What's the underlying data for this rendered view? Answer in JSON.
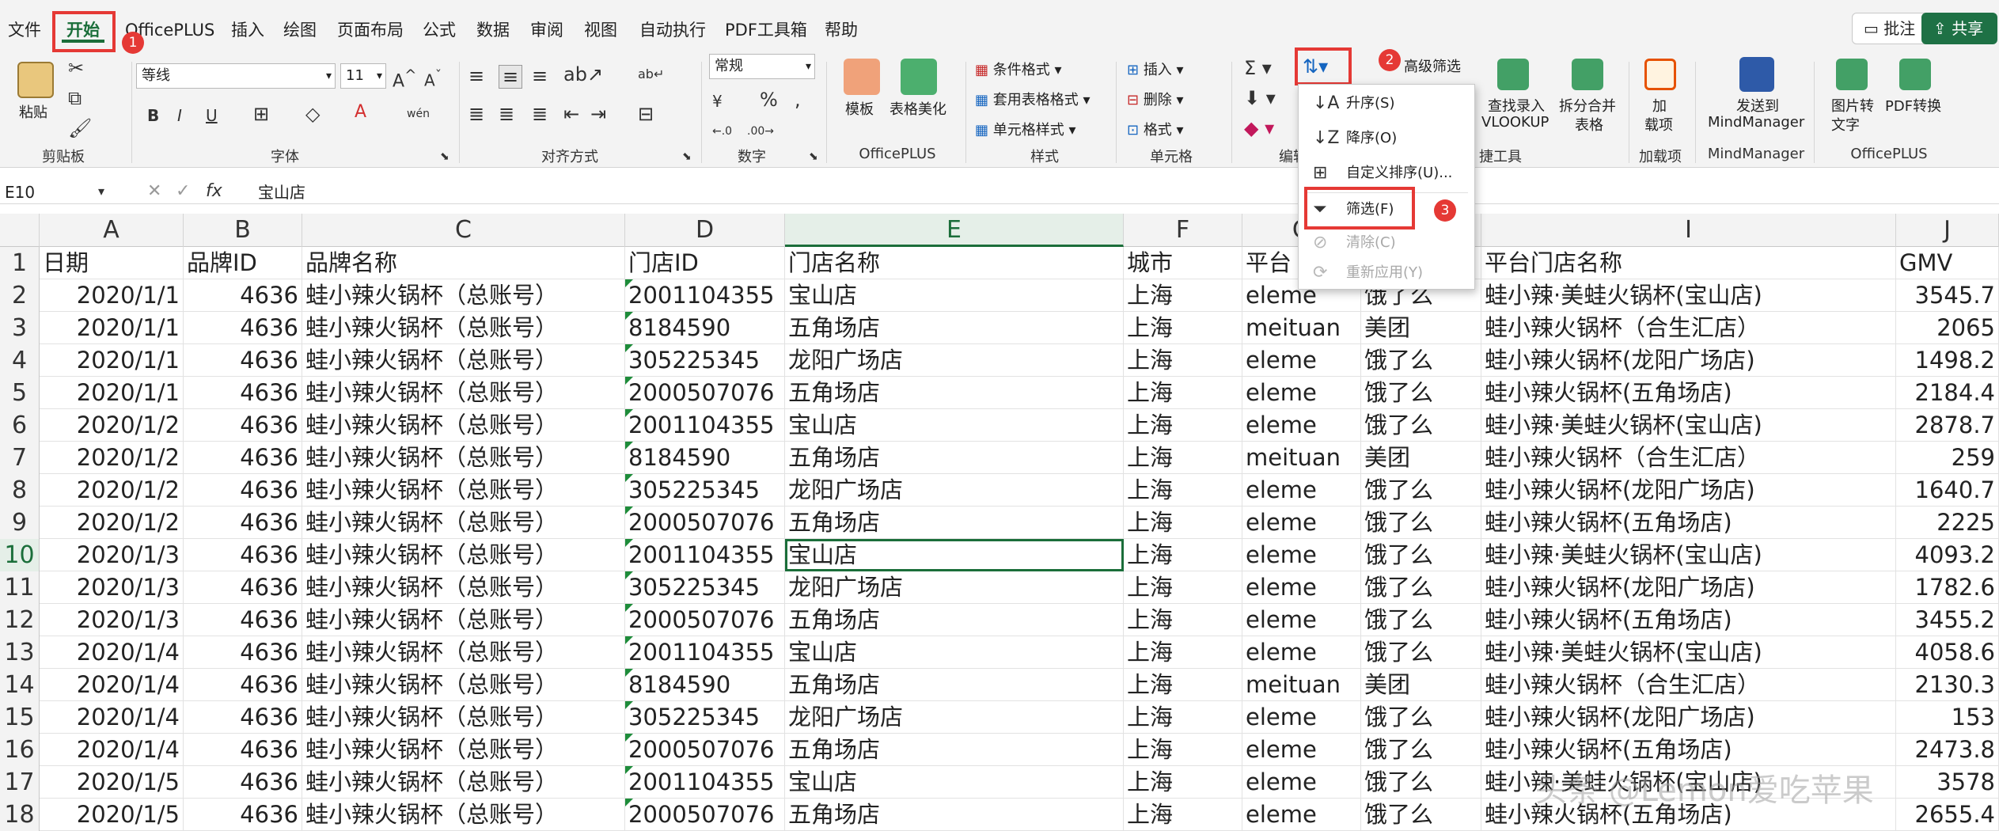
{
  "menu": {
    "tabs": [
      "文件",
      "开始",
      "OfficePLUS",
      "插入",
      "绘图",
      "页面布局",
      "公式",
      "数据",
      "审阅",
      "视图",
      "自动执行",
      "PDF工具箱",
      "帮助"
    ],
    "comment_btn": "批注",
    "share_btn": "共享"
  },
  "ribbon": {
    "clipboard": {
      "paste": "粘贴",
      "label": "剪贴板"
    },
    "font": {
      "name": "等线",
      "size": "11",
      "label": "字体"
    },
    "alignment": {
      "label": "对齐方式"
    },
    "number": {
      "format": "常规",
      "label": "数字"
    },
    "officeplus": {
      "template": "模板",
      "beautify": "表格美化",
      "label": "OfficePLUS"
    },
    "styles": {
      "cond": "条件格式",
      "table": "套用表格格式",
      "cell": "单元格样式",
      "label": "样式"
    },
    "cells": {
      "insert": "插入",
      "delete": "删除",
      "format": "格式",
      "label": "单元格"
    },
    "editing": {
      "label": "编辑"
    },
    "convenience": {
      "adv_filter": "高级筛选",
      "vlookup1": "查找录入",
      "vlookup2": "VLOOKUP",
      "split1": "拆分合并",
      "split2": "表格",
      "label": "捷工具"
    },
    "addins": {
      "btn1": "加",
      "btn2": "载项",
      "label": "加载项"
    },
    "mindmanager": {
      "btn1": "发送到",
      "btn2": "MindManager",
      "label": "MindManager"
    },
    "officeplus2": {
      "img1": "图片转",
      "img2": "文字",
      "pdf": "PDF转换",
      "label": "OfficePLUS"
    }
  },
  "formula_bar": {
    "name_box": "E10",
    "formula": "宝山店"
  },
  "sort_menu": {
    "items": [
      {
        "label": "升序(S)",
        "icon": "sort-ascending-icon",
        "enabled": true
      },
      {
        "label": "降序(O)",
        "icon": "sort-descending-icon",
        "enabled": true
      },
      {
        "label": "自定义排序(U)...",
        "icon": "custom-sort-icon",
        "enabled": true
      },
      {
        "label": "筛选(F)",
        "icon": "filter-icon",
        "enabled": true
      },
      {
        "label": "清除(C)",
        "icon": "clear-filter-icon",
        "enabled": false
      },
      {
        "label": "重新应用(Y)",
        "icon": "reapply-icon",
        "enabled": false
      }
    ]
  },
  "annotations": {
    "badge1": "1",
    "badge2": "2",
    "badge3": "3"
  },
  "sheet": {
    "columns": [
      "A",
      "B",
      "C",
      "D",
      "E",
      "F",
      "G",
      "H",
      "I",
      "J"
    ],
    "selected_column": "E",
    "row_numbers": [
      "1",
      "2",
      "3",
      "4",
      "5",
      "6",
      "7",
      "8",
      "9",
      "10",
      "11",
      "12",
      "13",
      "14",
      "15",
      "16",
      "17",
      "18"
    ],
    "selected_row": "10",
    "header": [
      "日期",
      "品牌ID",
      "品牌名称",
      "门店ID",
      "门店名称",
      "城市",
      "平台",
      "",
      "平台门店名称",
      "GMV"
    ],
    "rows": [
      [
        "2020/1/1",
        "4636",
        "蛙小辣火锅杯（总账号）",
        "2001104355",
        "宝山店",
        "上海",
        "eleme",
        "饿了么",
        "蛙小辣·美蛙火锅杯(宝山店)",
        "3545.7"
      ],
      [
        "2020/1/1",
        "4636",
        "蛙小辣火锅杯（总账号）",
        "8184590",
        "五角场店",
        "上海",
        "meituan",
        "美团",
        "蛙小辣火锅杯（合生汇店）",
        "2065"
      ],
      [
        "2020/1/1",
        "4636",
        "蛙小辣火锅杯（总账号）",
        "305225345",
        "龙阳广场店",
        "上海",
        "eleme",
        "饿了么",
        "蛙小辣火锅杯(龙阳广场店)",
        "1498.2"
      ],
      [
        "2020/1/1",
        "4636",
        "蛙小辣火锅杯（总账号）",
        "2000507076",
        "五角场店",
        "上海",
        "eleme",
        "饿了么",
        "蛙小辣火锅杯(五角场店)",
        "2184.4"
      ],
      [
        "2020/1/2",
        "4636",
        "蛙小辣火锅杯（总账号）",
        "2001104355",
        "宝山店",
        "上海",
        "eleme",
        "饿了么",
        "蛙小辣·美蛙火锅杯(宝山店)",
        "2878.7"
      ],
      [
        "2020/1/2",
        "4636",
        "蛙小辣火锅杯（总账号）",
        "8184590",
        "五角场店",
        "上海",
        "meituan",
        "美团",
        "蛙小辣火锅杯（合生汇店）",
        "259"
      ],
      [
        "2020/1/2",
        "4636",
        "蛙小辣火锅杯（总账号）",
        "305225345",
        "龙阳广场店",
        "上海",
        "eleme",
        "饿了么",
        "蛙小辣火锅杯(龙阳广场店)",
        "1640.7"
      ],
      [
        "2020/1/2",
        "4636",
        "蛙小辣火锅杯（总账号）",
        "2000507076",
        "五角场店",
        "上海",
        "eleme",
        "饿了么",
        "蛙小辣火锅杯(五角场店)",
        "2225"
      ],
      [
        "2020/1/3",
        "4636",
        "蛙小辣火锅杯（总账号）",
        "2001104355",
        "宝山店",
        "上海",
        "eleme",
        "饿了么",
        "蛙小辣·美蛙火锅杯(宝山店)",
        "4093.2"
      ],
      [
        "2020/1/3",
        "4636",
        "蛙小辣火锅杯（总账号）",
        "305225345",
        "龙阳广场店",
        "上海",
        "eleme",
        "饿了么",
        "蛙小辣火锅杯(龙阳广场店)",
        "1782.6"
      ],
      [
        "2020/1/3",
        "4636",
        "蛙小辣火锅杯（总账号）",
        "2000507076",
        "五角场店",
        "上海",
        "eleme",
        "饿了么",
        "蛙小辣火锅杯(五角场店)",
        "3455.2"
      ],
      [
        "2020/1/4",
        "4636",
        "蛙小辣火锅杯（总账号）",
        "2001104355",
        "宝山店",
        "上海",
        "eleme",
        "饿了么",
        "蛙小辣·美蛙火锅杯(宝山店)",
        "4058.6"
      ],
      [
        "2020/1/4",
        "4636",
        "蛙小辣火锅杯（总账号）",
        "8184590",
        "五角场店",
        "上海",
        "meituan",
        "美团",
        "蛙小辣火锅杯（合生汇店）",
        "2130.3"
      ],
      [
        "2020/1/4",
        "4636",
        "蛙小辣火锅杯（总账号）",
        "305225345",
        "龙阳广场店",
        "上海",
        "eleme",
        "饿了么",
        "蛙小辣火锅杯(龙阳广场店)",
        "153"
      ],
      [
        "2020/1/4",
        "4636",
        "蛙小辣火锅杯（总账号）",
        "2000507076",
        "五角场店",
        "上海",
        "eleme",
        "饿了么",
        "蛙小辣火锅杯(五角场店)",
        "2473.8"
      ],
      [
        "2020/1/5",
        "4636",
        "蛙小辣火锅杯（总账号）",
        "2001104355",
        "宝山店",
        "上海",
        "eleme",
        "饿了么",
        "蛙小辣·美蛙火锅杯(宝山店)",
        "3578"
      ],
      [
        "2020/1/5",
        "4636",
        "蛙小辣火锅杯（总账号）",
        "2000507076",
        "五角场店",
        "上海",
        "eleme",
        "饿了么",
        "蛙小辣火锅杯(五角场店)",
        "2655.4"
      ]
    ]
  },
  "watermark": "头条 @Lemon爱吃苹果"
}
